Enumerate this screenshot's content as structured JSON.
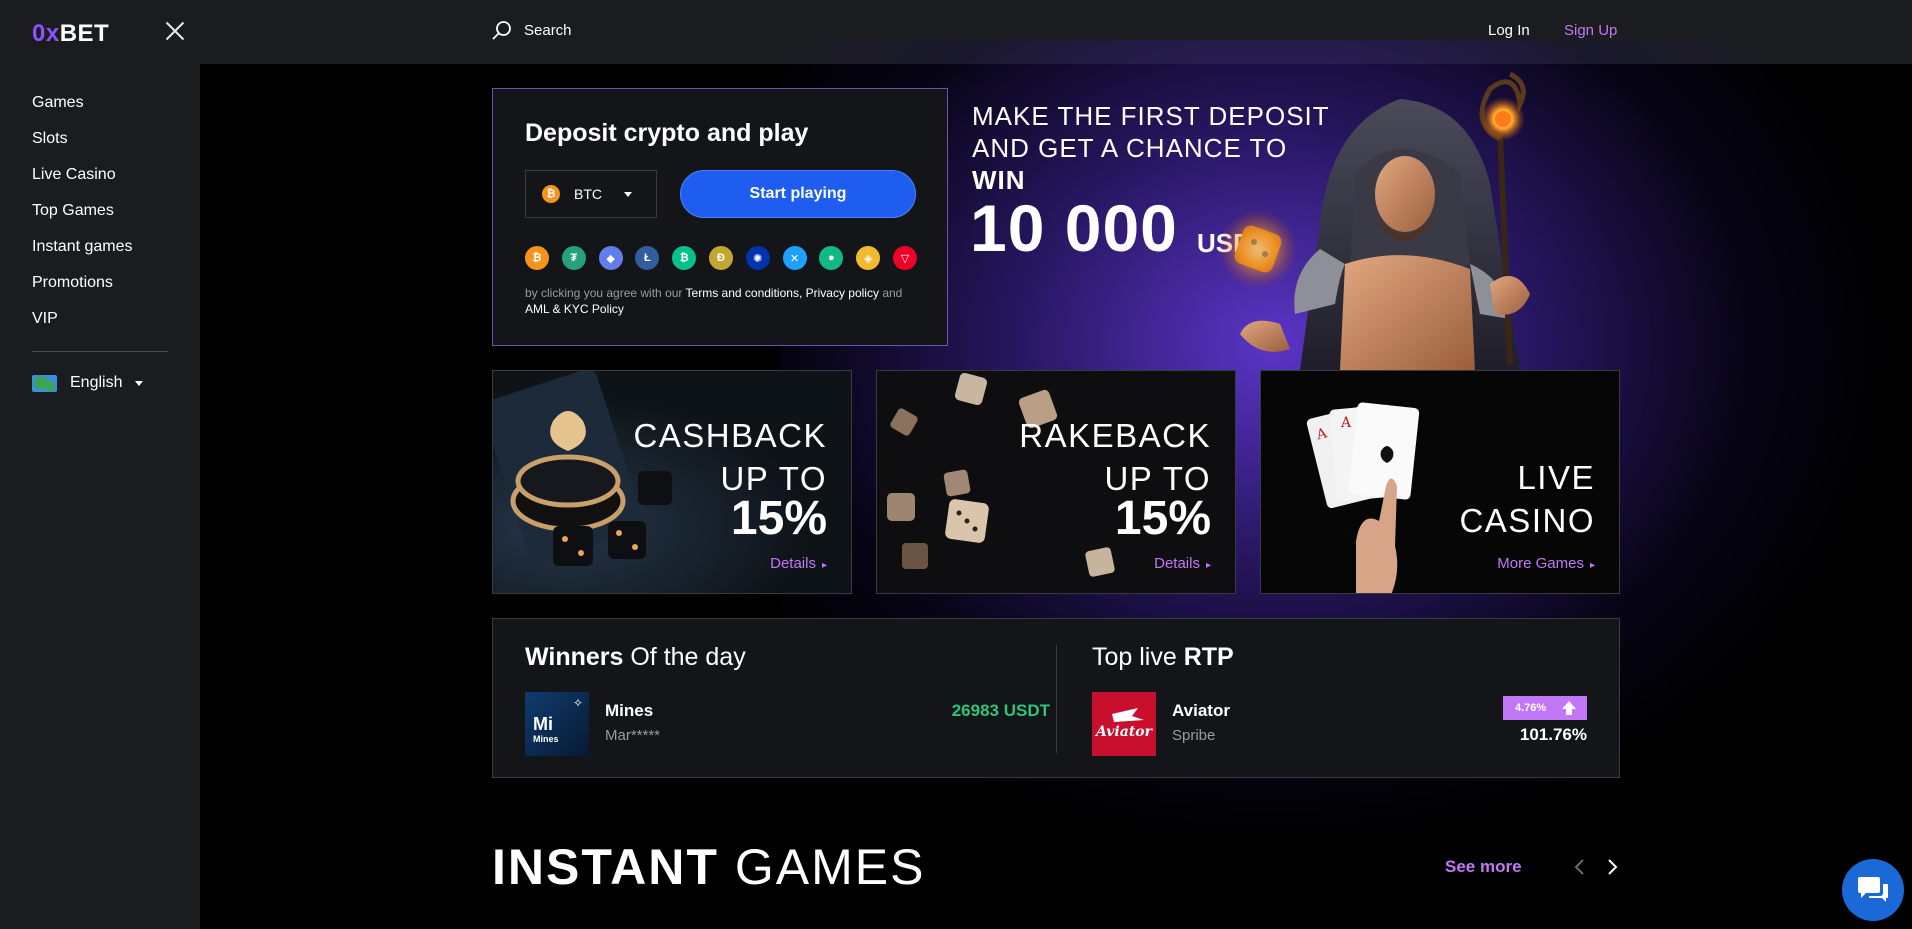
{
  "sidebar": {
    "logo_prefix": "0x",
    "logo_suffix": "BET",
    "items": [
      {
        "label": "Games"
      },
      {
        "label": "Slots"
      },
      {
        "label": "Live Casino"
      },
      {
        "label": "Top Games"
      },
      {
        "label": "Instant games"
      },
      {
        "label": "Promotions"
      },
      {
        "label": "VIP"
      }
    ],
    "language": "English"
  },
  "header": {
    "search_label": "Search",
    "login_label": "Log In",
    "signup_label": "Sign Up"
  },
  "deposit": {
    "title": "Deposit crypto and play",
    "selected_coin": "BTC",
    "start_label": "Start playing",
    "terms_prefix": "by clicking you agree with our",
    "terms_link": "Terms and conditions, Privacy policy",
    "terms_and": "and",
    "aml_link": "AML & KYC Policy",
    "coins": [
      {
        "name": "bitcoin-icon",
        "color": "#f7931a"
      },
      {
        "name": "tether-icon",
        "color": "#26a17b"
      },
      {
        "name": "ethereum-icon",
        "color": "#627eea"
      },
      {
        "name": "litecoin-icon",
        "color": "#345d9d"
      },
      {
        "name": "bitcoin-cash-icon",
        "color": "#0ac18e"
      },
      {
        "name": "dogecoin-icon",
        "color": "#c2a633"
      },
      {
        "name": "cardano-icon",
        "color": "#0033ad"
      },
      {
        "name": "ripple-icon",
        "color": "#1ea0ff"
      },
      {
        "name": "tron-usdc-icon",
        "color": "#12b886"
      },
      {
        "name": "binance-icon",
        "color": "#f3ba2f"
      },
      {
        "name": "tron-icon",
        "color": "#ef0027"
      }
    ]
  },
  "promo": {
    "line1": "MAKE THE FIRST DEPOSIT",
    "line2": "AND GET A CHANCE TO",
    "line3": "WIN",
    "amount": "10 000",
    "unit": "USDT"
  },
  "cards": [
    {
      "line1": "CASHBACK",
      "line2": "UP TO",
      "percent": "15%",
      "link": "Details"
    },
    {
      "line1": "RAKEBACK",
      "line2": "UP TO",
      "percent": "15%",
      "link": "Details"
    },
    {
      "line1": "LIVE",
      "line2": "CASINO",
      "link": "More Games"
    }
  ],
  "winners": {
    "title_bold": "Winners",
    "title_rest": "Of the day",
    "game": "Mines",
    "thumb_label": "Mi",
    "thumb_sub": "Mines",
    "user": "Mar*****",
    "amount": "26983 USDT"
  },
  "rtp": {
    "title_rest": "Top live",
    "title_bold": "RTP",
    "game": "Aviator",
    "provider": "Spribe",
    "badge": "4.76%",
    "value": "101.76%"
  },
  "instant": {
    "title_bold": "INSTANT",
    "title_rest": "GAMES",
    "see_more": "See more"
  },
  "colors": {
    "accent": "#c177f6",
    "primary_button": "#1f5cf0",
    "win_green": "#2ec57a",
    "sidebar_bg": "#1b1c20"
  }
}
